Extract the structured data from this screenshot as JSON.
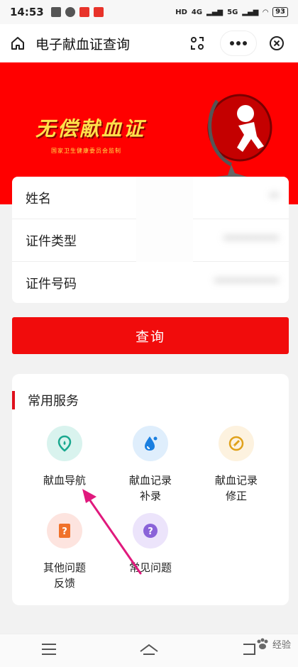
{
  "status_bar": {
    "time": "14:53",
    "network_1": "4G",
    "network_2": "5G",
    "hd_badge": "HD",
    "battery": "93"
  },
  "nav": {
    "title": "电子献血证查询",
    "icons": [
      "home-icon",
      "scan-icon",
      "more-icon",
      "close-icon"
    ]
  },
  "banner": {
    "title": "无偿献血证",
    "subtitle": "国家卫生健康委员会监制",
    "colors": {
      "background": "#ff0000",
      "title": "#ffe04a"
    }
  },
  "form": {
    "rows": [
      {
        "label": "姓名",
        "value": "**"
      },
      {
        "label": "证件类型",
        "value": "************"
      },
      {
        "label": "证件号码",
        "value": "**************"
      }
    ]
  },
  "query_button": {
    "label": "查询",
    "color": "#f10c0c"
  },
  "services": {
    "title": "常用服务",
    "items": [
      {
        "label": "献血导航",
        "icon": "location-pin-icon",
        "bg": "#d9f3ee",
        "fg": "#1aa88f"
      },
      {
        "label": "献血记录\n补录",
        "icon": "blood-drop-icon",
        "bg": "#dfeefc",
        "fg": "#1a7fe0"
      },
      {
        "label": "献血记录\n修正",
        "icon": "edit-pencil-icon",
        "bg": "#fdf2df",
        "fg": "#e0a11a"
      },
      {
        "label": "其他问题\n反馈",
        "icon": "feedback-icon",
        "bg": "#fde4df",
        "fg": "#f0712a"
      },
      {
        "label": "常见问题",
        "icon": "question-icon",
        "bg": "#ece4fb",
        "fg": "#8a63d8"
      }
    ]
  },
  "watermark": {
    "text": "经验"
  }
}
